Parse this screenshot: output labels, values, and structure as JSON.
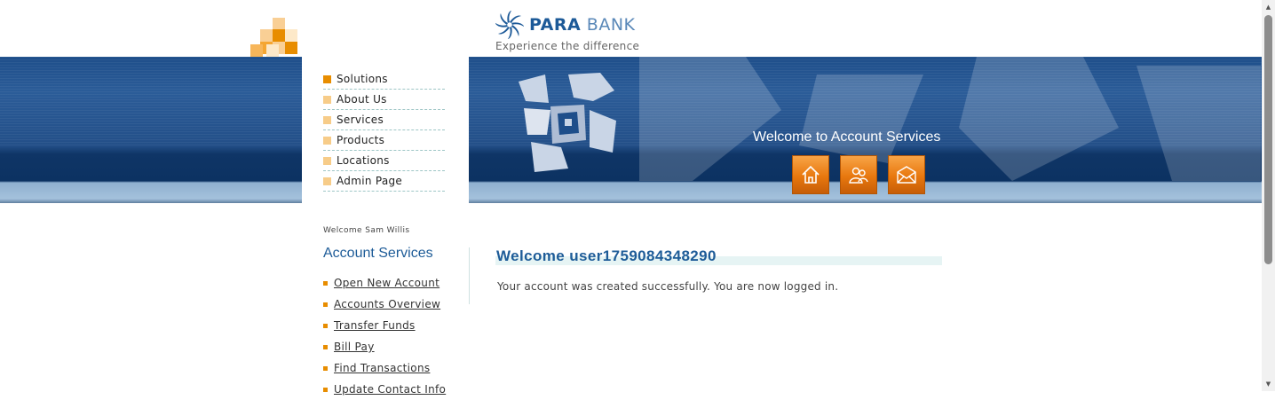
{
  "brand": {
    "name_part1": "PARA",
    "name_part2": "BANK",
    "tagline": "Experience the difference",
    "colors": {
      "primary": "#1e5c98",
      "accent": "#e88d00",
      "band": "#1e4e8a"
    }
  },
  "top_menu": {
    "items": [
      {
        "label": "Solutions"
      },
      {
        "label": "About Us"
      },
      {
        "label": "Services"
      },
      {
        "label": "Products"
      },
      {
        "label": "Locations"
      },
      {
        "label": "Admin Page"
      }
    ]
  },
  "banner": {
    "welcome": "Welcome to Account Services",
    "icons": [
      "home-icon",
      "contact-icon",
      "mail-icon"
    ]
  },
  "sidebar": {
    "user_welcome": "Welcome Sam Willis",
    "title": "Account Services",
    "links": [
      {
        "label": "Open New Account"
      },
      {
        "label": "Accounts Overview"
      },
      {
        "label": "Transfer Funds"
      },
      {
        "label": "Bill Pay"
      },
      {
        "label": "Find Transactions"
      },
      {
        "label": "Update Contact Info"
      }
    ]
  },
  "main": {
    "title": "Welcome user1759084348290",
    "message": "Your account was created successfully. You are now logged in."
  }
}
